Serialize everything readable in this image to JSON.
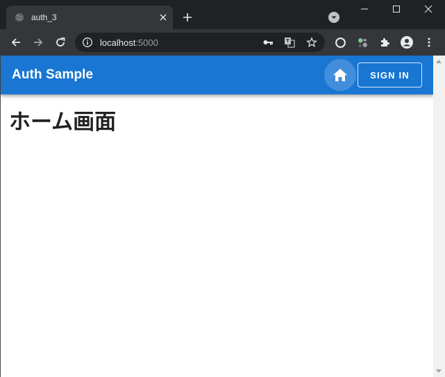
{
  "browser": {
    "tab": {
      "title": "auth_3"
    },
    "omnibox": {
      "host": "localhost",
      "port": ":5000"
    }
  },
  "app": {
    "title": "Auth Sample",
    "signin_label": "SIGN IN",
    "heading": "ホーム画面"
  },
  "colors": {
    "appbar": "#1976d2",
    "chrome_dark": "#202124",
    "chrome_toolbar": "#35363a"
  },
  "icons": [
    "globe-icon",
    "close-icon",
    "plus-icon",
    "tab-search-icon",
    "minimize-icon",
    "maximize-icon",
    "window-close-icon",
    "back-icon",
    "forward-icon",
    "reload-icon",
    "info-icon",
    "key-icon",
    "translate-icon",
    "star-icon",
    "extension-compass-icon",
    "extension-tool-icon",
    "puzzle-icon",
    "profile-icon",
    "more-icon",
    "home-icon"
  ]
}
